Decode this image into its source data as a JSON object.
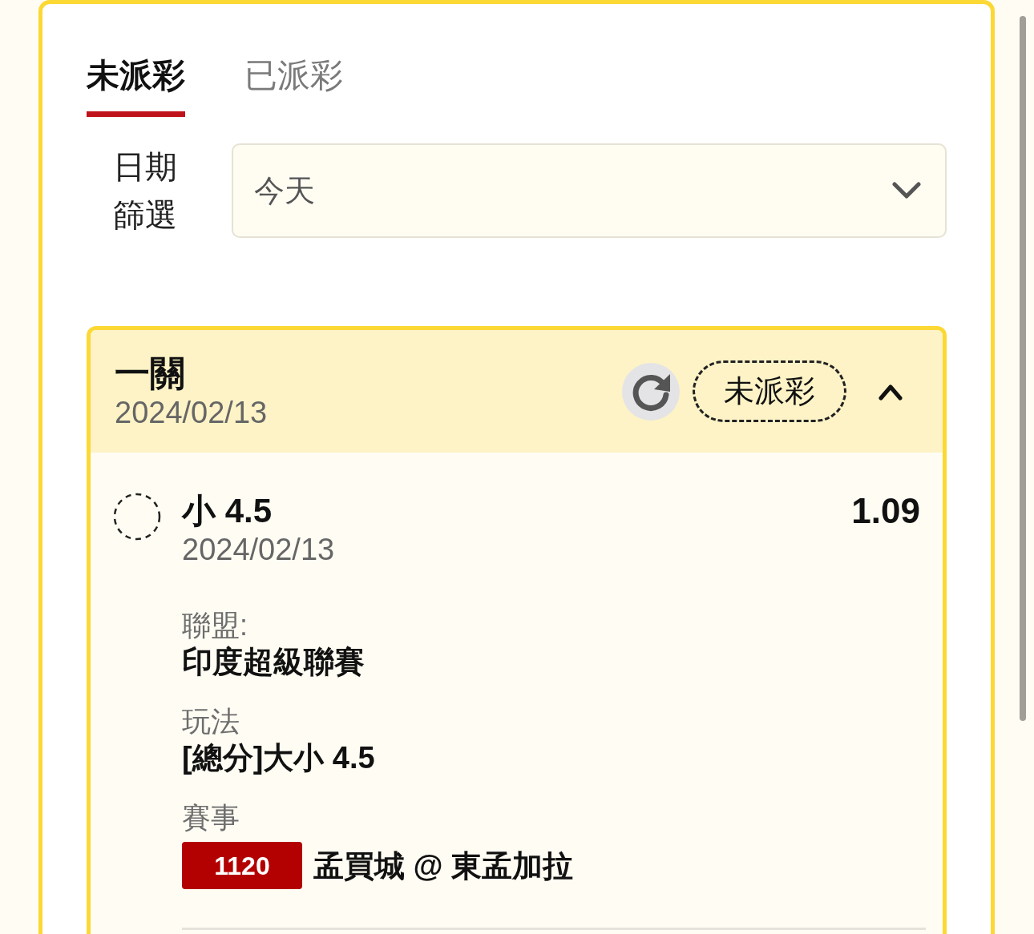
{
  "tabs": [
    {
      "label": "未派彩",
      "selected": true
    },
    {
      "label": "已派彩",
      "selected": false
    }
  ],
  "date_filter": {
    "label": "日期篩選",
    "value": "今天"
  },
  "bets": [
    {
      "type": "一關",
      "date": "2024/02/13",
      "status": "未派彩",
      "expanded": true,
      "selections": [
        {
          "pick": "小 4.5",
          "odds": "1.09",
          "date": "2024/02/13",
          "details": [
            {
              "kind": "text",
              "label": "聯盟:",
              "value": "印度超級聯賽"
            },
            {
              "kind": "text",
              "label": "玩法",
              "value": "[總分]大小 4.5"
            },
            {
              "kind": "match",
              "label": "賽事",
              "match_no": "1120",
              "value": "孟買城 @ 東孟加拉"
            }
          ]
        }
      ]
    }
  ]
}
